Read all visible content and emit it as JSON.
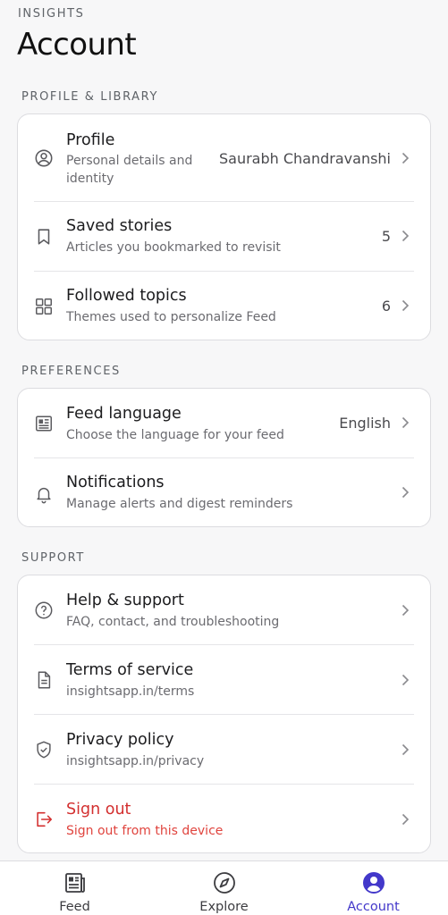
{
  "app_label": "INSIGHTS",
  "page_title": "Account",
  "sections": {
    "profile_library": {
      "header": "PROFILE & LIBRARY",
      "profile": {
        "title": "Profile",
        "subtitle_line1": "Personal details and",
        "subtitle_line2": "identity",
        "value": "Saurabh Chandravanshi",
        "icon": "user-circle-icon"
      },
      "saved": {
        "title": "Saved stories",
        "subtitle": "Articles you bookmarked to revisit",
        "value": "5",
        "icon": "bookmark-icon"
      },
      "topics": {
        "title": "Followed topics",
        "subtitle": "Themes used to personalize Feed",
        "value": "6",
        "icon": "grid-icon"
      }
    },
    "preferences": {
      "header": "PREFERENCES",
      "language": {
        "title": "Feed language",
        "subtitle": "Choose the language for your feed",
        "value": "English",
        "icon": "newspaper-icon"
      },
      "notifications": {
        "title": "Notifications",
        "subtitle": "Manage alerts and digest reminders",
        "icon": "bell-icon"
      }
    },
    "support": {
      "header": "SUPPORT",
      "help": {
        "title": "Help & support",
        "subtitle": "FAQ, contact, and troubleshooting",
        "icon": "question-circle-icon"
      },
      "terms": {
        "title": "Terms of service",
        "subtitle": "insightsapp.in/terms",
        "icon": "document-icon"
      },
      "privacy": {
        "title": "Privacy policy",
        "subtitle": "insightsapp.in/privacy",
        "icon": "shield-check-icon"
      },
      "signout": {
        "title": "Sign out",
        "subtitle": "Sign out from this device",
        "icon": "logout-icon"
      }
    }
  },
  "bottom_nav": {
    "feed": {
      "label": "Feed",
      "icon": "newspaper-icon"
    },
    "explore": {
      "label": "Explore",
      "icon": "compass-icon"
    },
    "account": {
      "label": "Account",
      "icon": "user-circle-icon",
      "active": true
    }
  },
  "colors": {
    "accent": "#4338ca",
    "danger": "#d32f2f",
    "background": "#f7f7f8"
  }
}
